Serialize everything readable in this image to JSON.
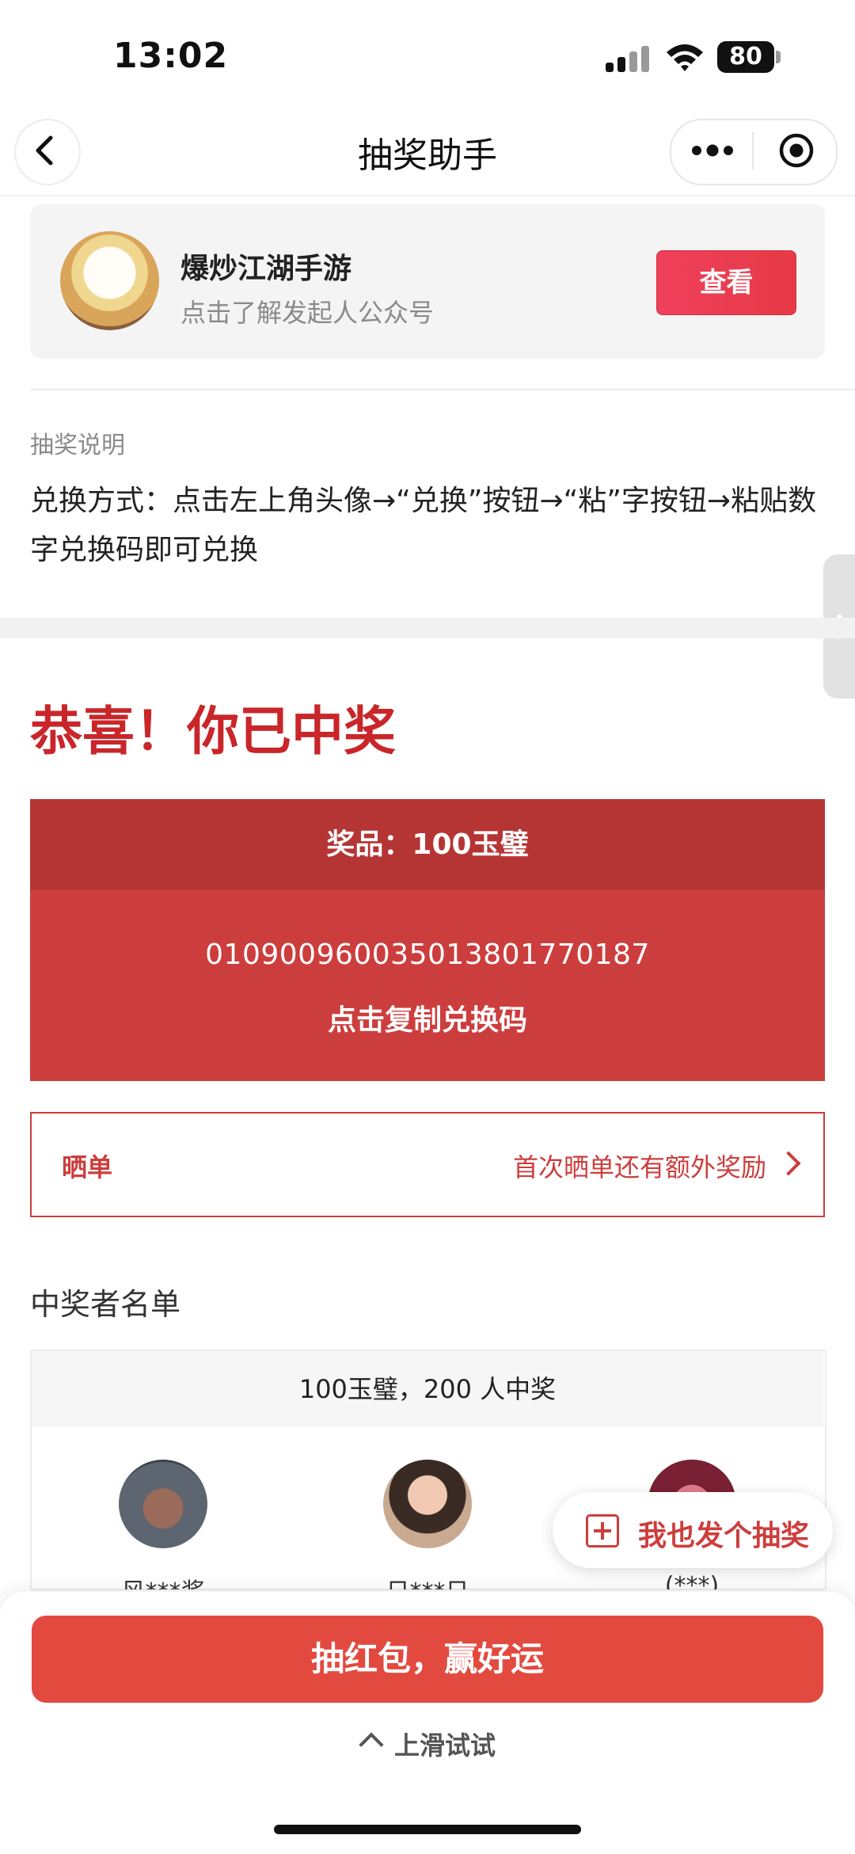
{
  "status_bar": {
    "time": "13:02",
    "battery": "80"
  },
  "nav": {
    "title": "抽奖助手"
  },
  "sponsor": {
    "name": "爆炒江湖手游",
    "subtitle": "点击了解发起人公众号",
    "button": "查看"
  },
  "description": {
    "label": "抽奖说明",
    "text": "兑换方式：点击左上角头像→“兑换”按钮→“粘”字按钮→粘贴数字兑换码即可兑换"
  },
  "result": {
    "title": "恭喜！你已中奖",
    "prize": "奖品：100玉璧",
    "code": "010900960035013801770187",
    "copy": "点击复制兑换码"
  },
  "share": {
    "label": "晒单",
    "hint": "首次晒单还有额外奖励"
  },
  "winners": {
    "title": "中奖者名单",
    "summary": "100玉璧，200 人中奖",
    "list": [
      {
        "name": "风***酱"
      },
      {
        "name": "日***日"
      },
      {
        "name": "(***)"
      }
    ]
  },
  "float_button": {
    "label": "我也发个抽奖"
  },
  "bottom": {
    "button": "抽红包，赢好运",
    "hint": "上滑试试"
  },
  "colors": {
    "accent": "#cc3e3d",
    "prize_header": "#b53535",
    "primary_button": "#e24a40"
  }
}
